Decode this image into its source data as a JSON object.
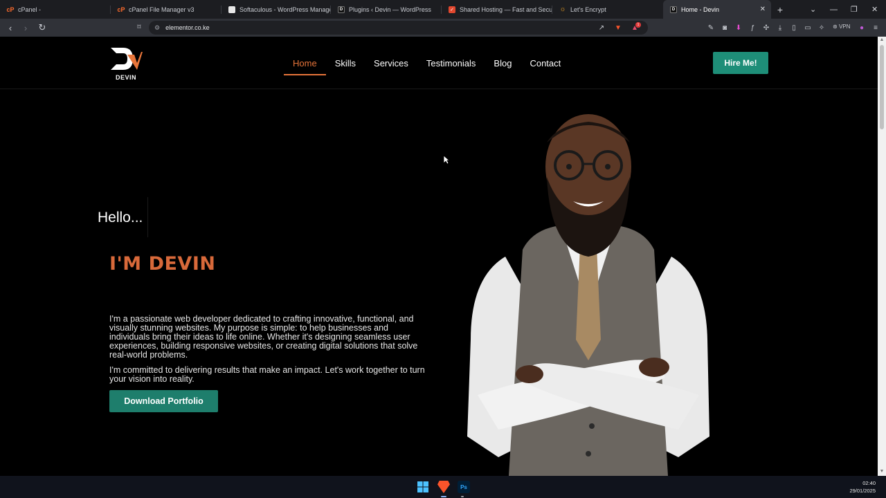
{
  "browser": {
    "tabs": [
      {
        "title": "cPanel -",
        "favicon": "cpanel-icon",
        "active": false
      },
      {
        "title": "cPanel File Manager v3",
        "favicon": "cpanel-icon",
        "active": false
      },
      {
        "title": "Softaculous - WordPress Managem",
        "favicon": "softaculous-icon",
        "active": false
      },
      {
        "title": "Plugins ‹ Devin — WordPress",
        "favicon": "wordpress-icon",
        "active": false
      },
      {
        "title": "Shared Hosting — Fast and Secure",
        "favicon": "hosting-icon",
        "active": false
      },
      {
        "title": "Let's Encrypt",
        "favicon": "letsencrypt-icon",
        "active": false
      },
      {
        "title": "Home - Devin",
        "favicon": "devin-icon",
        "active": true
      }
    ],
    "url": "elementor.co.ke",
    "vpn_label": "VPN",
    "notification_count": "1"
  },
  "site": {
    "logo_text": "DEVIN",
    "menu": [
      "Home",
      "Skills",
      "Services",
      "Testimonials",
      "Blog",
      "Contact"
    ],
    "active_menu": "Home",
    "hire_label": "Hire Me!",
    "hello": "Hello...",
    "name": "I'M DEVIN",
    "intro_1": "I'm a passionate web developer dedicated to crafting innovative, functional, and visually stunning websites. My purpose is simple: to help businesses and individuals bring their ideas to life online. Whether it's designing seamless user experiences, building responsive websites, or creating digital solutions that solve real-world problems.",
    "intro_2": "I'm committed to delivering results that make an impact. Let's work together to turn your vision into reality.",
    "download_label": "Download Portfolio"
  },
  "colors": {
    "accent_orange": "#e8753a",
    "name_orange": "#d8693a",
    "button_teal": "#1e8e78",
    "background": "#000000"
  },
  "taskbar": {
    "time": "02:40",
    "date": "29/01/2025"
  }
}
